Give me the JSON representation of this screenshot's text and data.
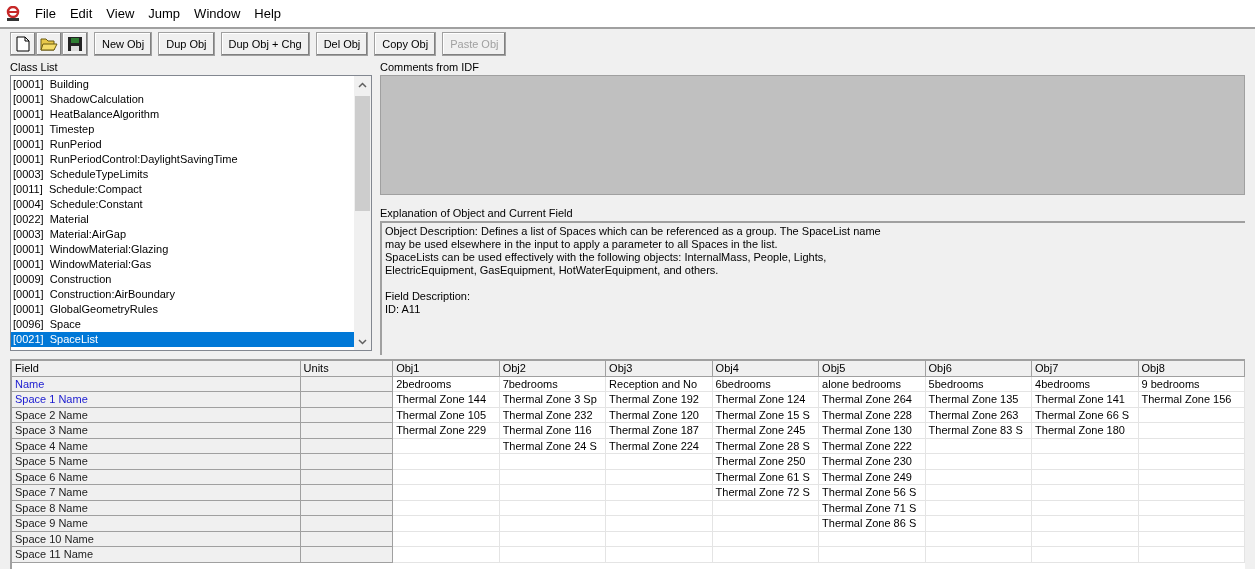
{
  "menu": [
    "File",
    "Edit",
    "View",
    "Jump",
    "Window",
    "Help"
  ],
  "toolbar": {
    "icon_buttons": [
      {
        "kind": "new"
      },
      {
        "kind": "open"
      },
      {
        "kind": "save"
      }
    ],
    "buttons": [
      {
        "label": "New Obj",
        "disabled": false
      },
      {
        "label": "Dup Obj",
        "disabled": false
      },
      {
        "label": "Dup Obj + Chg",
        "disabled": false
      },
      {
        "label": "Del Obj",
        "disabled": false
      },
      {
        "label": "Copy Obj",
        "disabled": false
      },
      {
        "label": "Paste Obj",
        "disabled": true
      }
    ]
  },
  "class_list": {
    "label": "Class List",
    "items": [
      {
        "text": "[0001]  Building",
        "selected": false
      },
      {
        "text": "[0001]  ShadowCalculation",
        "selected": false
      },
      {
        "text": "[0001]  HeatBalanceAlgorithm",
        "selected": false
      },
      {
        "text": "[0001]  Timestep",
        "selected": false
      },
      {
        "text": "[0001]  RunPeriod",
        "selected": false
      },
      {
        "text": "[0001]  RunPeriodControl:DaylightSavingTime",
        "selected": false
      },
      {
        "text": "[0003]  ScheduleTypeLimits",
        "selected": false
      },
      {
        "text": "[0011]  Schedule:Compact",
        "selected": false
      },
      {
        "text": "[0004]  Schedule:Constant",
        "selected": false
      },
      {
        "text": "[0022]  Material",
        "selected": false
      },
      {
        "text": "[0003]  Material:AirGap",
        "selected": false
      },
      {
        "text": "[0001]  WindowMaterial:Glazing",
        "selected": false
      },
      {
        "text": "[0001]  WindowMaterial:Gas",
        "selected": false
      },
      {
        "text": "[0009]  Construction",
        "selected": false
      },
      {
        "text": "[0001]  Construction:AirBoundary",
        "selected": false
      },
      {
        "text": "[0001]  GlobalGeometryRules",
        "selected": false
      },
      {
        "text": "[0096]  Space",
        "selected": false
      },
      {
        "text": "[0021]  SpaceList",
        "selected": true
      }
    ]
  },
  "comments": {
    "label": "Comments from IDF"
  },
  "explanation": {
    "label": "Explanation of Object and Current Field",
    "lines": [
      "Object Description: Defines a list of Spaces which can be referenced as a group. The SpaceList name",
      "may be used elsewhere in the input to apply a parameter to all Spaces in the list.",
      "SpaceLists can be used effectively with the following objects: InternalMass, People, Lights,",
      "ElectricEquipment, GasEquipment, HotWaterEquipment, and others."
    ],
    "field_lines": [
      "Field Description:",
      "ID: A11"
    ]
  },
  "grid": {
    "field_header": "Field",
    "units_header": "Units",
    "fields": [
      {
        "name": "Name",
        "required": true
      },
      {
        "name": "Space 1 Name",
        "required": true
      },
      {
        "name": "Space 2 Name",
        "required": false
      },
      {
        "name": "Space 3 Name",
        "required": false
      },
      {
        "name": "Space 4 Name",
        "required": false
      },
      {
        "name": "Space 5 Name",
        "required": false
      },
      {
        "name": "Space 6 Name",
        "required": false
      },
      {
        "name": "Space 7 Name",
        "required": false
      },
      {
        "name": "Space 8 Name",
        "required": false
      },
      {
        "name": "Space 9 Name",
        "required": false
      },
      {
        "name": "Space 10 Name",
        "required": false
      },
      {
        "name": "Space 11 Name",
        "required": false
      }
    ],
    "objects": [
      {
        "header": "Obj1",
        "values": [
          "2bedrooms",
          "Thermal Zone 144",
          "Thermal Zone 105",
          "Thermal Zone 229"
        ]
      },
      {
        "header": "Obj2",
        "values": [
          "7bedrooms",
          "Thermal Zone 3 Sp",
          "Thermal Zone 232",
          "Thermal Zone 116",
          "Thermal Zone 24 S"
        ]
      },
      {
        "header": "Obj3",
        "values": [
          "Reception and No",
          "Thermal Zone 192",
          "Thermal Zone 120",
          "Thermal Zone 187",
          "Thermal Zone 224"
        ]
      },
      {
        "header": "Obj4",
        "values": [
          "6bedrooms",
          "Thermal Zone 124",
          "Thermal Zone 15 S",
          "Thermal Zone 245",
          "Thermal Zone 28 S",
          "Thermal Zone 250",
          "Thermal Zone 61 S",
          "Thermal Zone 72 S"
        ]
      },
      {
        "header": "Obj5",
        "values": [
          "alone bedrooms",
          "Thermal Zone 264",
          "Thermal Zone 228",
          "Thermal Zone 130",
          "Thermal Zone 222",
          "Thermal Zone 230",
          "Thermal Zone 249",
          "Thermal Zone 56 S",
          "Thermal Zone 71 S",
          "Thermal Zone 86 S"
        ]
      },
      {
        "header": "Obj6",
        "values": [
          "5bedrooms",
          "Thermal Zone 135",
          "Thermal Zone 263",
          "Thermal Zone 83 S"
        ]
      },
      {
        "header": "Obj7",
        "values": [
          "4bedrooms",
          "Thermal Zone 141",
          "Thermal Zone 66 S",
          "Thermal Zone 180"
        ]
      },
      {
        "header": "Obj8",
        "values": [
          "9 bedrooms",
          "Thermal Zone 156"
        ]
      }
    ]
  }
}
